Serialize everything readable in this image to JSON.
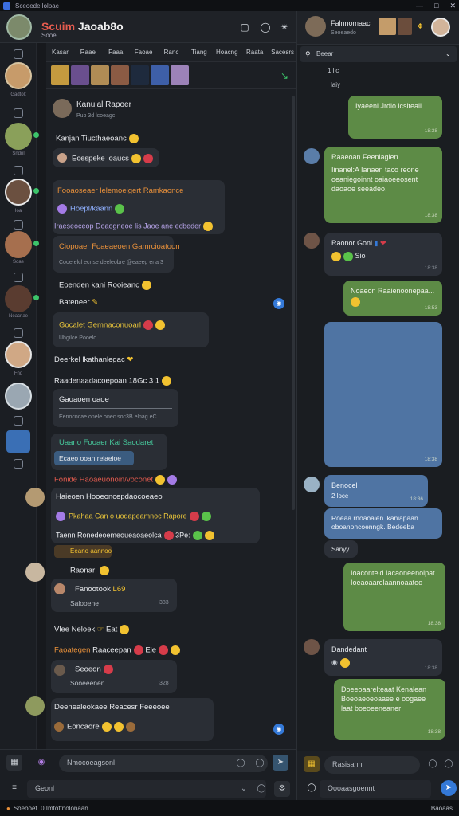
{
  "window": {
    "title": "Sceoede lolpac"
  },
  "header": {
    "title_a": "Scuim",
    "title_b": "Jaoab8o",
    "subtitle": "Sooel"
  },
  "tabs": [
    "Kasar",
    "Raae",
    "Faaa",
    "Faoae",
    "Ranc",
    "Tiang",
    "Hoacng",
    "Raata",
    "Sacesrs"
  ],
  "feed": {
    "pinned_name": "Kanujal Rapoer",
    "pinned_meta": "Pub 3d lcoeagc",
    "m1": "Kanjan Tiucthaeoanc",
    "m2": "Ecespeke loaucs",
    "m3_a": "Fooaoseaer lelemoeigert Ramkaonce",
    "m3_b": "Hoepl/kaann",
    "m3_c": "Iraeseoceop Doaogneoe lis Jaoe ane ecbeder",
    "m4_a": "Ciopoaer Foaeaeoen Gamrcioatoon",
    "m4_b": "Cooe elcl ecnse deeleobre @eaeeg ena 3",
    "m5": "Eoenden kani Rooieanc",
    "m6": "Bateneer",
    "m7_a": "Gocalet Gemnaconuoarl",
    "m7_b": "Uhgilce Pooelo",
    "m8": "Deerkel lkathanlegac",
    "m9": "Raadenaadacoepoan",
    "m9_b": "18Gc 3 1",
    "m10_a": "Gaoaoen oaoe",
    "m10_b": "Eenocncae onele onec soc3B elnag eC",
    "m11_a": "Uaano Fooaer Kai Saodaret",
    "m11_b": "Ecaeo ooan relaeioe",
    "m12": "Fonide Haoaeuonoin/voconet",
    "m13_a": "Haieoen Hooeoncepdaocoeaeo",
    "m13_b": "Pkahaa Can o uodapeamnoc Rapore",
    "m13_c": "Taenn Ronedeoemeoueaoaeolca",
    "m13_d": "3Pe:",
    "m14": "Eeano aannoo",
    "m15": "Raonar:",
    "m16_a": "Fanootook",
    "m16_b": "Salooene",
    "m16_c": "L69",
    "m17": "Vlee Neloek",
    "m17_b": "Eat",
    "m18_a": "Faoategen",
    "m18_b": "Raaceepan",
    "m18_c": "Ele",
    "m19_a": "Seoeon",
    "m19_b": "Sooeeenen",
    "m20_a": "Deenealeokaee Reacesr Feeeoee",
    "m20_b": "Eoncaore",
    "t1": "383",
    "t2": "328",
    "t3": "328"
  },
  "composer": {
    "placeholder": "Nmocoeagsonl",
    "search": "Geonl"
  },
  "right": {
    "title": "Falnnomaac",
    "subtitle": "Seoeaedo",
    "search": "Beear",
    "b0_a": "1 llc",
    "b0_b": "laiy",
    "b1": "Iyaeeni Jrdlo lcsiteall.",
    "b1_t": "18:38",
    "b2_name": "Raaeoan Feenlagien",
    "b2": "Iinanel:A Ianaen taco reone oeaniegoinnt oaiaoeeosent daoaoe seeadeo.",
    "b2_t": "18:38",
    "b3_name": "Raonor Gonl",
    "b3_b": "Sio",
    "b3_t": "18:38",
    "b4": "Noaeon Raaienoonepaa...",
    "b4_t": "18:53",
    "b5_t": "18:38",
    "b6_name": "Benocel",
    "b6_sub": "2 loce",
    "b6_t": "18:36",
    "b7": "Roeaa rnoaoaien lkaniapaan. oboanoncoenngk. Bedeeba",
    "b8": "Sanyy",
    "b9": "Ioaconteid Iacaoneenoipat. Ioeaoaarolaannoaatoo",
    "b9_t": "18:38",
    "b10_name": "Dandedant",
    "b10_t": "18:38",
    "b11": "Doeeoaarelteaat Kenalean Boeoaeoeoaaee e oogaee laat boeoeeneaner",
    "b11_t": "18:38",
    "input": "Rasisann",
    "input2": "Oooaasgoennt"
  },
  "status": {
    "left": "Soeooet. 0 Imtottnolonaan",
    "right": "Baoaas"
  }
}
